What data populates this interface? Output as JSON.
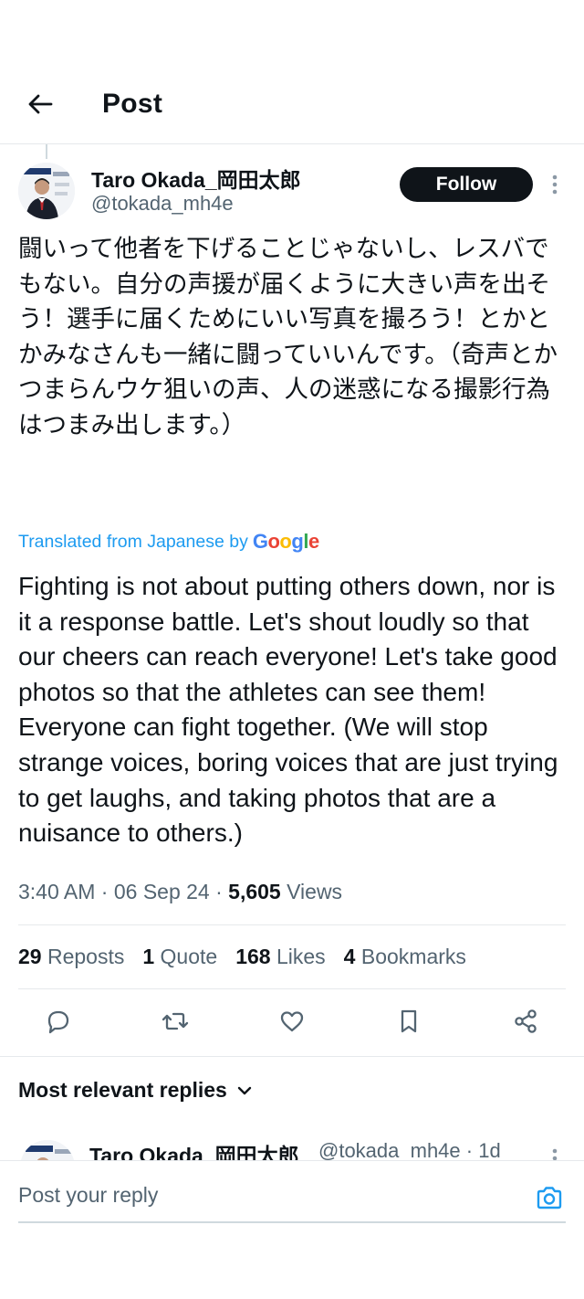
{
  "header": {
    "title": "Post"
  },
  "post": {
    "author_name": "Taro Okada_岡田太郎",
    "author_handle": "@tokada_mh4e",
    "follow_label": "Follow",
    "text_original": "闘いって他者を下げることじゃないし、レスバでもない。自分の声援が届くように大きい声を出そう！選手に届くためにいい写真を撮ろう！とかとかみなさんも一緒に闘っていいんです。（奇声とかつまらんウケ狙いの声、人の迷惑になる撮影行為はつまみ出します。）",
    "translated_label": "Translated from Japanese by",
    "translation_provider": "Google",
    "text_translated": "Fighting is not about putting others down, nor is it a response battle. Let's shout loudly so that our cheers can reach everyone! Let's take good photos so that the athletes can see them! Everyone can fight together. (We will stop strange voices, boring voices that are just trying to get laughs, and taking photos that are a nuisance to others.)",
    "time": "3:40 AM",
    "date": "06 Sep 24",
    "views_count": "5,605",
    "views_label": "Views",
    "separator": "·"
  },
  "stats": {
    "reposts_count": "29",
    "reposts_label": "Reposts",
    "quotes_count": "1",
    "quotes_label": "Quote",
    "likes_count": "168",
    "likes_label": "Likes",
    "bookmarks_count": "4",
    "bookmarks_label": "Bookmarks"
  },
  "actions": [
    "reply-icon",
    "repost-icon",
    "like-icon",
    "bookmark-icon",
    "share-icon"
  ],
  "replies": {
    "sort_label": "Most relevant replies",
    "first_reply": {
      "author_name": "Taro Okada_岡田太郎",
      "handle_time": "@tokada_mh4e · 1d"
    }
  },
  "compose": {
    "placeholder": "Post your reply"
  },
  "colors": {
    "accent": "#1d9bf0",
    "text": "#0f1419",
    "secondary": "#536471",
    "border": "#e6e9ec"
  }
}
